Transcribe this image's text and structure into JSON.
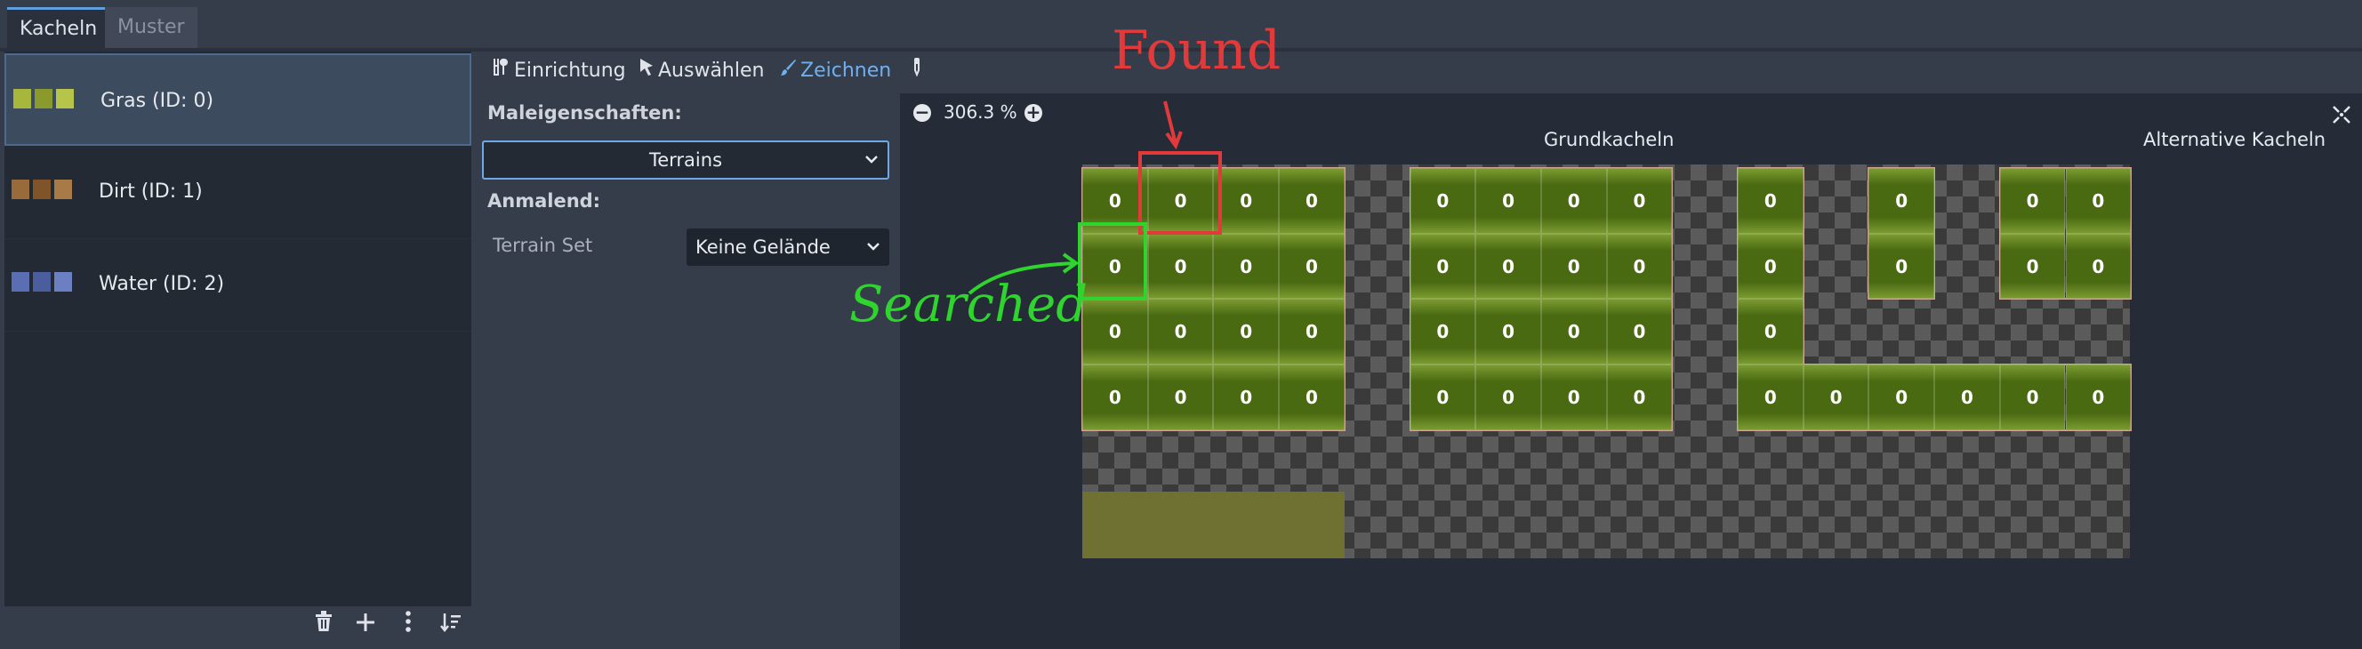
{
  "tabs": {
    "kacheln": "Kacheln",
    "muster": "Muster"
  },
  "sources": [
    {
      "label": "Gras (ID: 0)",
      "color": "#a7b73c"
    },
    {
      "label": "Dirt (ID: 1)",
      "color": "#9a6b3a"
    },
    {
      "label": "Water (ID: 2)",
      "color": "#5a6fb3"
    }
  ],
  "toolbar": {
    "einrichtung": "Einrichtung",
    "auswaehlen": "Auswählen",
    "zeichnen": "Zeichnen"
  },
  "paint": {
    "properties_label": "Maleigenschaften:",
    "property_value": "Terrains",
    "painting_label": "Anmalend:",
    "terrain_set_label": "Terrain Set",
    "terrain_set_value": "Keine Gelände"
  },
  "canvas": {
    "zoom": "306.3 %",
    "base_tiles_header": "Grundkacheln",
    "alt_tiles_header": "Alternative Kacheln",
    "tile_value": "0"
  },
  "annotations": {
    "found": "Found",
    "searched": "Searched"
  },
  "colors": {
    "accent": "#5f9fe0",
    "found": "#e23a3a",
    "searched": "#2fd42f"
  }
}
